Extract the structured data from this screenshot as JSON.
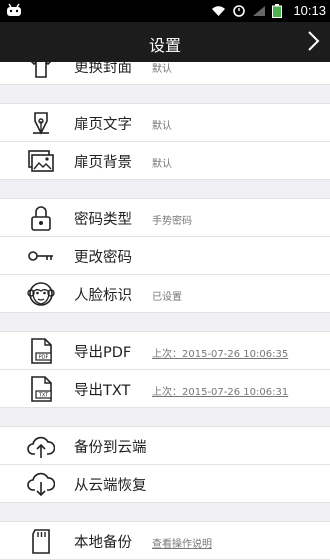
{
  "status_bar": {
    "time": "10:13"
  },
  "title_bar": {
    "title": "设置"
  },
  "settings": {
    "cover": {
      "label": "更换封面",
      "value": "默认"
    },
    "flyleaf_text": {
      "label": "扉页文字",
      "value": "默认"
    },
    "flyleaf_bg": {
      "label": "扉页背景",
      "value": "默认"
    },
    "password_type": {
      "label": "密码类型",
      "value": "手势密码"
    },
    "change_password": {
      "label": "更改密码"
    },
    "face_id": {
      "label": "人脸标识",
      "value": "已设置"
    },
    "export_pdf": {
      "label": "导出PDF",
      "value": "上次：2015-07-26 10:06:35"
    },
    "export_txt": {
      "label": "导出TXT",
      "value": "上次：2015-07-26 10:06:31"
    },
    "backup_cloud": {
      "label": "备份到云端"
    },
    "restore_cloud": {
      "label": "从云端恢复"
    },
    "local_backup": {
      "label": "本地备份",
      "value": "查看操作说明"
    }
  }
}
